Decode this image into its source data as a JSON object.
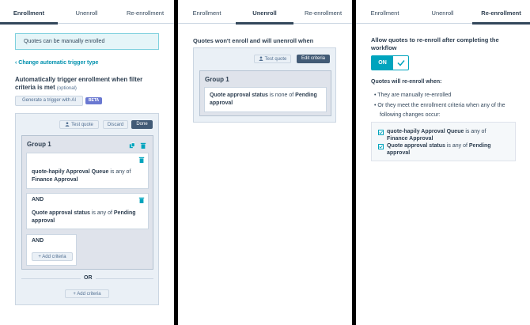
{
  "tabs": [
    "Enrollment",
    "Unenroll",
    "Re-enrollment"
  ],
  "enrollment": {
    "banner": "Quotes can be manually enrolled",
    "change_trigger_link": "Change automatic trigger type",
    "heading_line1": "Automatically trigger enrollment when filter",
    "heading_line2": "criteria is met",
    "optional": "(optional)",
    "ai_button": "Generate a trigger with AI",
    "beta_badge": "BETA",
    "toolbar": {
      "test": "Test quote",
      "discard": "Discard",
      "done": "Done"
    },
    "group_title": "Group 1",
    "criteria1": {
      "prop": "quote-hapily Approval Queue",
      "op": "is any of",
      "value": "Finance Approval"
    },
    "and1": "AND",
    "criteria2": {
      "prop": "Quote approval status",
      "op": "is any of",
      "value_line1": "Pending",
      "value_line2": "approval"
    },
    "and2": "AND",
    "add_criteria_inner": "Add criteria",
    "or_label": "OR",
    "add_criteria_outer": "Add criteria"
  },
  "unenroll": {
    "heading": "Quotes won't enroll and will unenroll when",
    "test_button": "Test quote",
    "edit_button": "Edit criteria",
    "group_title": "Group 1",
    "criteria": {
      "prop": "Quote approval status",
      "op": "is none of",
      "value": "Pending",
      "value2": "approval"
    }
  },
  "reenroll": {
    "heading_line1": "Allow quotes to re-enroll after completing the",
    "heading_line2": "workflow",
    "toggle_label": "ON",
    "subheading": "Quotes will re-enroll when:",
    "bullets": [
      "They are manually re-enrolled",
      "Or they meet the enrollment criteria when any of the",
      "following changes occur:"
    ],
    "check1": {
      "prop": "quote-hapily Approval Queue",
      "op": "is any of",
      "value": "Finance Approval"
    },
    "check2": {
      "prop": "Quote approval status",
      "op": "is any of",
      "value": "Pending",
      "value2": "approval"
    }
  },
  "colors": {
    "teal": "#00a4bd",
    "dark": "#425b76",
    "link": "#0091ae",
    "beta": "#6a78d1",
    "banner_bg": "#e5f5f8"
  },
  "icons": [
    "user-icon",
    "trash-icon",
    "copy-icon",
    "plus-icon",
    "chevron-left-icon",
    "check-icon"
  ]
}
